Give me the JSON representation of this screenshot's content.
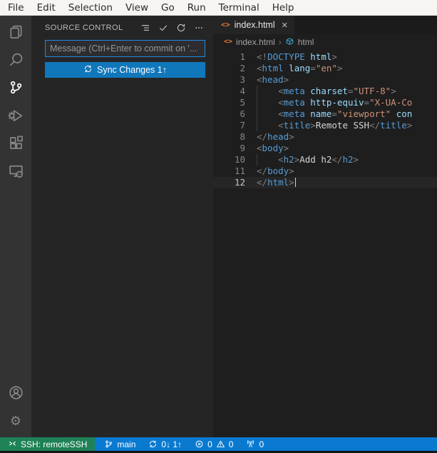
{
  "menubar": {
    "items": [
      "File",
      "Edit",
      "Selection",
      "View",
      "Go",
      "Run",
      "Terminal",
      "Help"
    ]
  },
  "activity_bar": {
    "top": [
      {
        "icon": "explorer-icon",
        "active": false
      },
      {
        "icon": "search-icon",
        "active": false
      },
      {
        "icon": "source-control-icon",
        "active": true
      },
      {
        "icon": "run-debug-icon",
        "active": false
      },
      {
        "icon": "extensions-icon",
        "active": false
      },
      {
        "icon": "remote-explorer-icon",
        "active": false
      }
    ],
    "bottom": [
      {
        "icon": "account-icon",
        "active": false
      },
      {
        "icon": "settings-gear-icon",
        "active": false
      }
    ]
  },
  "sidebar": {
    "title": "SOURCE CONTROL",
    "actions": [
      "view-as-tree-icon",
      "commit-check-icon",
      "refresh-icon",
      "more-actions-icon"
    ],
    "commit_input": {
      "placeholder": "Message (Ctrl+Enter to commit on '..."
    },
    "sync_button": {
      "icon": "sync-icon",
      "label": "Sync Changes 1↑"
    }
  },
  "editor": {
    "tab": {
      "icon": "html-code-icon",
      "label": "index.html",
      "close_icon": "close-icon"
    },
    "breadcrumb": {
      "file": "index.html",
      "separator": "›",
      "symbol": "html"
    },
    "code": {
      "language": "html",
      "lines": [
        {
          "n": 1,
          "g": false,
          "a": false,
          "t": [
            [
              "p",
              "<!"
            ],
            [
              "k",
              "DOCTYPE"
            ],
            [
              "d",
              " "
            ],
            [
              "a",
              "html"
            ],
            [
              "p",
              ">"
            ]
          ]
        },
        {
          "n": 2,
          "g": false,
          "a": false,
          "t": [
            [
              "p",
              "<"
            ],
            [
              "k",
              "html"
            ],
            [
              "d",
              " "
            ],
            [
              "a",
              "lang"
            ],
            [
              "p",
              "="
            ],
            [
              "v",
              "\"en\""
            ],
            [
              "p",
              ">"
            ]
          ]
        },
        {
          "n": 3,
          "g": false,
          "a": false,
          "t": [
            [
              "p",
              "<"
            ],
            [
              "k",
              "head"
            ],
            [
              "p",
              ">"
            ]
          ]
        },
        {
          "n": 4,
          "g": true,
          "a": false,
          "t": [
            [
              "d",
              "    "
            ],
            [
              "p",
              "<"
            ],
            [
              "k",
              "meta"
            ],
            [
              "d",
              " "
            ],
            [
              "a",
              "charset"
            ],
            [
              "p",
              "="
            ],
            [
              "v",
              "\"UTF-8\""
            ],
            [
              "p",
              ">"
            ]
          ]
        },
        {
          "n": 5,
          "g": true,
          "a": false,
          "t": [
            [
              "d",
              "    "
            ],
            [
              "p",
              "<"
            ],
            [
              "k",
              "meta"
            ],
            [
              "d",
              " "
            ],
            [
              "a",
              "http-equiv"
            ],
            [
              "p",
              "="
            ],
            [
              "v",
              "\"X-UA-Co"
            ]
          ]
        },
        {
          "n": 6,
          "g": true,
          "a": false,
          "t": [
            [
              "d",
              "    "
            ],
            [
              "p",
              "<"
            ],
            [
              "k",
              "meta"
            ],
            [
              "d",
              " "
            ],
            [
              "a",
              "name"
            ],
            [
              "p",
              "="
            ],
            [
              "v",
              "\"viewport\""
            ],
            [
              "d",
              " "
            ],
            [
              "a",
              "con"
            ]
          ]
        },
        {
          "n": 7,
          "g": true,
          "a": false,
          "t": [
            [
              "d",
              "    "
            ],
            [
              "p",
              "<"
            ],
            [
              "k",
              "title"
            ],
            [
              "p",
              ">"
            ],
            [
              "d",
              "Remote SSH"
            ],
            [
              "p",
              "</"
            ],
            [
              "k",
              "title"
            ],
            [
              "p",
              ">"
            ]
          ]
        },
        {
          "n": 8,
          "g": false,
          "a": false,
          "t": [
            [
              "p",
              "</"
            ],
            [
              "k",
              "head"
            ],
            [
              "p",
              ">"
            ]
          ]
        },
        {
          "n": 9,
          "g": false,
          "a": false,
          "t": [
            [
              "p",
              "<"
            ],
            [
              "k",
              "body"
            ],
            [
              "p",
              ">"
            ]
          ]
        },
        {
          "n": 10,
          "g": true,
          "a": false,
          "t": [
            [
              "d",
              "    "
            ],
            [
              "p",
              "<"
            ],
            [
              "k",
              "h2"
            ],
            [
              "p",
              ">"
            ],
            [
              "d",
              "Add h2"
            ],
            [
              "p",
              "</"
            ],
            [
              "k",
              "h2"
            ],
            [
              "p",
              ">"
            ]
          ]
        },
        {
          "n": 11,
          "g": false,
          "a": false,
          "t": [
            [
              "p",
              "</"
            ],
            [
              "k",
              "body"
            ],
            [
              "p",
              ">"
            ]
          ]
        },
        {
          "n": 12,
          "g": false,
          "a": true,
          "t": [
            [
              "p",
              "</"
            ],
            [
              "k",
              "html"
            ],
            [
              "p",
              ">"
            ]
          ]
        }
      ]
    }
  },
  "status_bar": {
    "segments": [
      {
        "name": "remote-status",
        "style": "remote",
        "parts": [
          {
            "icon": "remote-icon"
          },
          {
            "text": "SSH: remoteSSH"
          }
        ]
      },
      {
        "name": "branch-status",
        "style": "",
        "parts": [
          {
            "icon": "git-branch-icon"
          },
          {
            "text": "main"
          }
        ]
      },
      {
        "name": "sync-status",
        "style": "",
        "parts": [
          {
            "icon": "sync-icon"
          },
          {
            "text": "0↓ 1↑"
          }
        ]
      },
      {
        "name": "problems-status",
        "style": "",
        "parts": [
          {
            "icon": "error-icon"
          },
          {
            "text": "0"
          },
          {
            "icon": "warning-icon"
          },
          {
            "text": "0"
          }
        ]
      },
      {
        "name": "ports-status",
        "style": "",
        "parts": [
          {
            "icon": "radio-tower-icon"
          },
          {
            "text": "0"
          }
        ]
      }
    ]
  },
  "colors": {
    "statusbar_blue": "#0a7ad1",
    "remote_green": "#1e8256",
    "button_blue": "#1177bb",
    "focus_border": "#2488db",
    "activity_bar_bg": "#333333",
    "sidebar_bg": "#252526",
    "editor_bg": "#1e1e1e",
    "tag_color": "#569cd6",
    "attr_color": "#9cdcfe",
    "value_color": "#ce9178",
    "punct_color": "#808080",
    "html_icon_orange": "#e37933",
    "symbol_cube_blue": "#3fa9e0"
  }
}
